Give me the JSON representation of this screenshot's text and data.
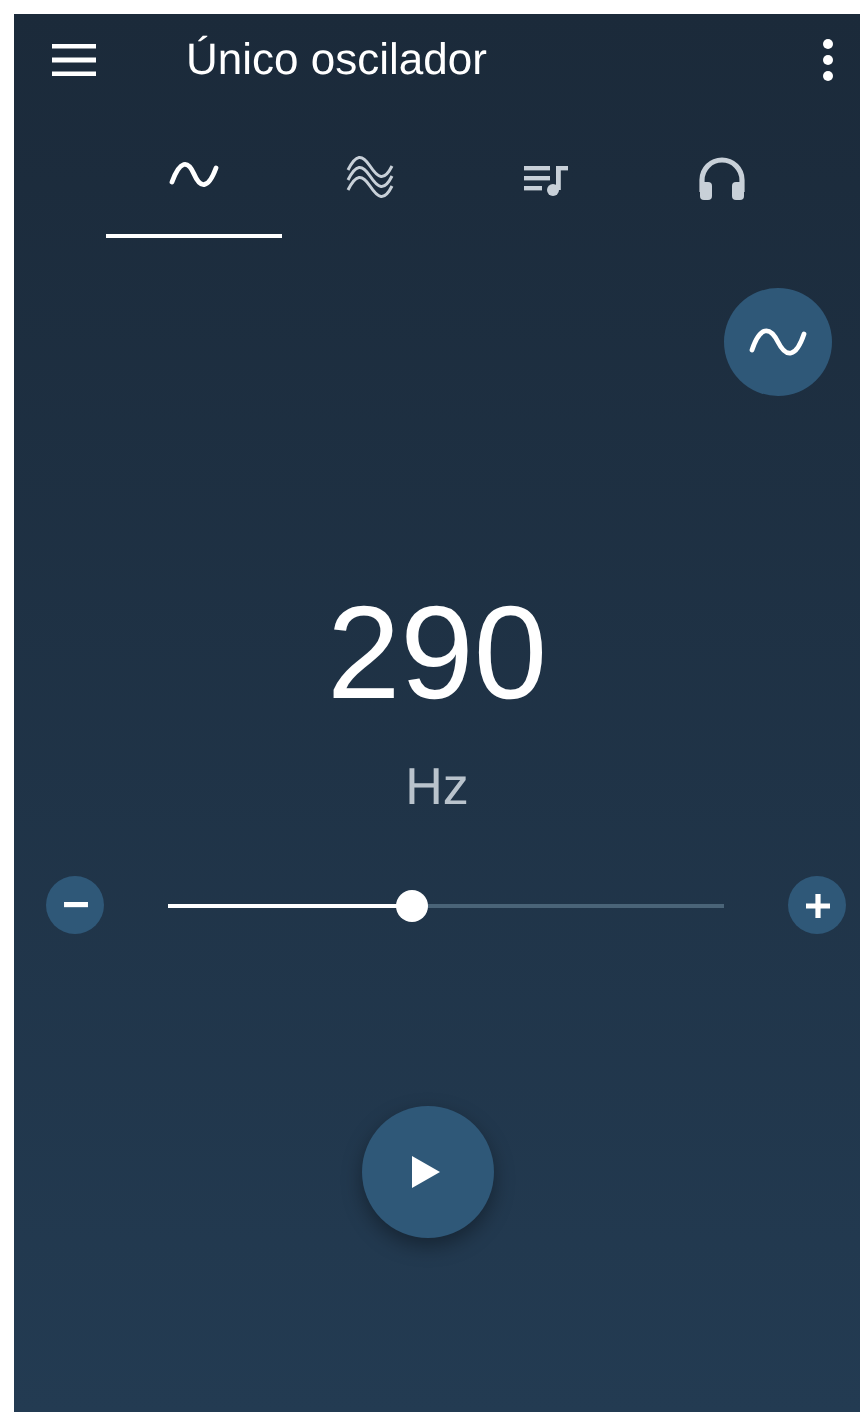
{
  "app_bar": {
    "title": "Único oscilador"
  },
  "tabs": [
    {
      "kind": "sine",
      "selected": true
    },
    {
      "kind": "multi",
      "selected": false
    },
    {
      "kind": "playlist",
      "selected": false
    },
    {
      "kind": "headphones",
      "selected": false
    }
  ],
  "frequency": {
    "value": "290",
    "unit": "Hz"
  },
  "slider": {
    "level": 0.44
  }
}
